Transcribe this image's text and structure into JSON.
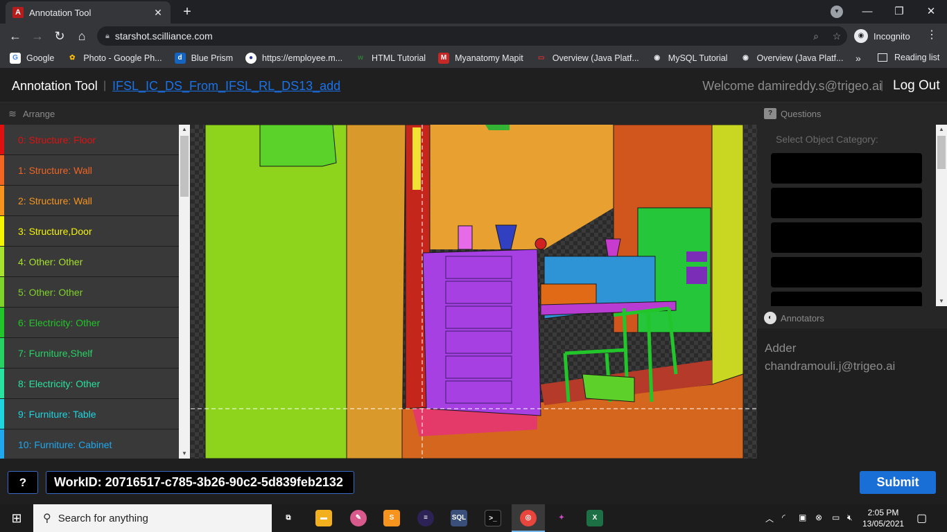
{
  "browser": {
    "tab_title": "Annotation Tool",
    "tab_favicon": "A",
    "tab_close": "✕",
    "new_tab": "+",
    "url": "starshot.scilliance.com",
    "profile_label": "Incognito",
    "reading_list": "Reading list",
    "bookmarks_more": "»",
    "bookmarks": [
      {
        "label": "Google",
        "icon": "G",
        "color": "#4285f4"
      },
      {
        "label": "Photo - Google Ph...",
        "icon": "✿",
        "color": "#fbbc05"
      },
      {
        "label": "Blue Prism",
        "icon": "d",
        "color": "#1565c0"
      },
      {
        "label": "https://employee.m...",
        "icon": "●",
        "color": "#283593"
      },
      {
        "label": "HTML Tutorial",
        "icon": "w",
        "color": "#2e7d32"
      },
      {
        "label": "Myanatomy Mapit",
        "icon": "M",
        "color": "#c62828"
      },
      {
        "label": "Overview (Java Platf...",
        "icon": "▭",
        "color": "#d32f2f"
      },
      {
        "label": "MySQL Tutorial",
        "icon": "◉",
        "color": "#616161"
      },
      {
        "label": "Overview (Java Platf...",
        "icon": "◉",
        "color": "#616161"
      }
    ]
  },
  "app": {
    "title": "Annotation Tool",
    "separator": "|",
    "project": "IFSL_IC_DS_From_IFSL_RL_DS13_add",
    "welcome": "Welcome damireddy.s@trigeo.ai",
    "logout": "Log Out"
  },
  "left_panel": {
    "heading": "Arrange",
    "layers": [
      {
        "label": "0: Structure: Floor",
        "color": "#e01010"
      },
      {
        "label": "1: Structure: Wall",
        "color": "#f26522"
      },
      {
        "label": "2: Structure: Wall",
        "color": "#f7941d"
      },
      {
        "label": "3: Structure,Door",
        "color": "#f5f500"
      },
      {
        "label": "4: Other: Other",
        "color": "#a6e22e"
      },
      {
        "label": "5: Other: Other",
        "color": "#7fd32b"
      },
      {
        "label": "6: Electricity: Other",
        "color": "#22c52a"
      },
      {
        "label": "7: Furniture,Shelf",
        "color": "#27d365"
      },
      {
        "label": "8: Electricity: Other",
        "color": "#29e3a0"
      },
      {
        "label": "9: Furniture: Table",
        "color": "#1fd6e0"
      },
      {
        "label": "10: Furniture: Cabinet",
        "color": "#1fa8ee"
      }
    ]
  },
  "right_panel": {
    "questions_heading": "Questions",
    "select_label": "Select Object Category:",
    "annotators_heading": "Annotators",
    "annotators": [
      "Adder",
      "chandramouli.j@trigeo.ai"
    ]
  },
  "footer": {
    "help": "?",
    "work_id": "WorkID: 20716517-c785-3b26-90c2-5d839feb2132",
    "submit": "Submit"
  },
  "taskbar": {
    "search_placeholder": "Search for anything",
    "time": "2:05 PM",
    "date": "13/05/2021"
  }
}
